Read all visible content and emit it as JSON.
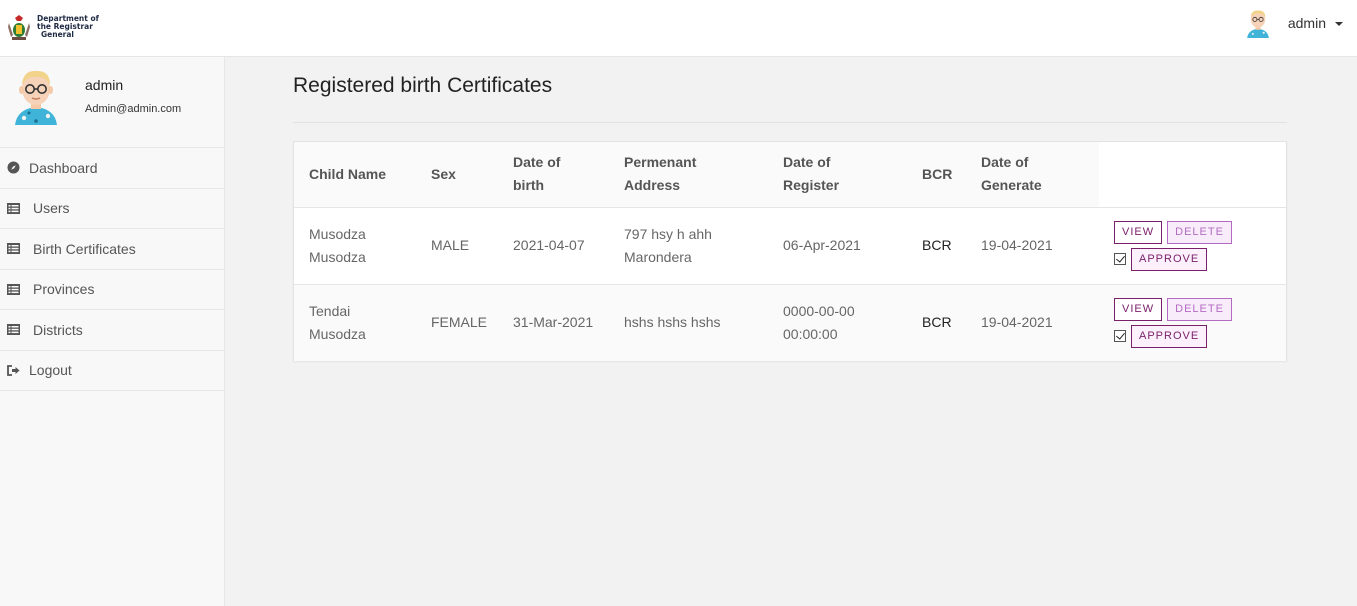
{
  "header": {
    "logo_lines": [
      "Department of",
      "the Registrar",
      "General"
    ],
    "user_name": "admin"
  },
  "sidebar": {
    "profile": {
      "name": "admin",
      "email": "Admin@admin.com"
    },
    "items": [
      {
        "label": "Dashboard",
        "icon": "compass-icon"
      },
      {
        "label": "Users",
        "icon": "list-icon"
      },
      {
        "label": "Birth Certificates",
        "icon": "list-icon"
      },
      {
        "label": "Provinces",
        "icon": "list-icon"
      },
      {
        "label": "Districts",
        "icon": "list-icon"
      },
      {
        "label": "Logout",
        "icon": "sign-out-icon"
      }
    ]
  },
  "main": {
    "title": "Registered birth Certificates",
    "columns": {
      "child_name": "Child Name",
      "sex": "Sex",
      "dob_1": "Date of",
      "dob_2": "birth",
      "addr_1": "Permenant",
      "addr_2": "Address",
      "reg_1": "Date of",
      "reg_2": "Register",
      "bcr": "BCR",
      "gen_1": "Date of",
      "gen_2": "Generate"
    },
    "rows": [
      {
        "name_1": "Musodza",
        "name_2": "Musodza",
        "sex": "MALE",
        "dob": "2021-04-07",
        "addr_1": "797 hsy h ahh",
        "addr_2": "Marondera",
        "reg_1": "06-Apr-2021",
        "reg_2": "",
        "bcr": "BCR",
        "generated": "19-04-2021",
        "actions": {
          "view": "VIEW",
          "delete": "DELETE",
          "approve": "APPROVE"
        }
      },
      {
        "name_1": "Tendai",
        "name_2": "Musodza",
        "sex": "FEMALE",
        "dob": "31-Mar-2021",
        "addr_1": "hshs hshs hshs",
        "addr_2": "",
        "reg_1": "0000-00-00",
        "reg_2": "00:00:00",
        "bcr": "BCR",
        "generated": "19-04-2021",
        "actions": {
          "view": "VIEW",
          "delete": "DELETE",
          "approve": "APPROVE"
        }
      }
    ]
  }
}
